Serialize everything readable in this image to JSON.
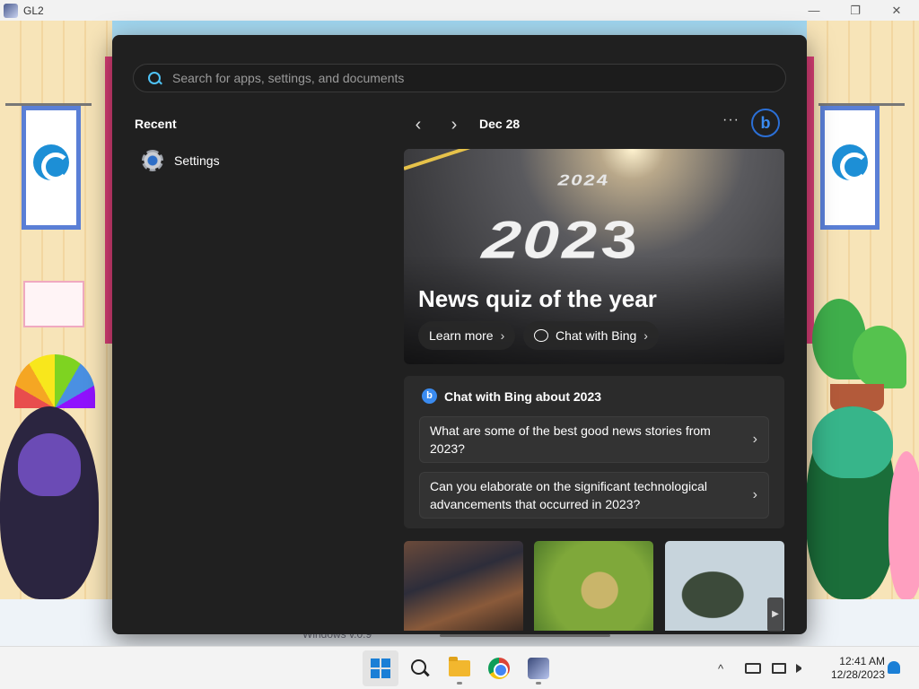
{
  "window": {
    "title": "GL2",
    "minimize": "—",
    "maximize": "❐",
    "close": "✕"
  },
  "game": {
    "footer_text": "Windows v.0.9"
  },
  "start_menu": {
    "search": {
      "placeholder": "Search for apps, settings, and documents",
      "value": ""
    },
    "recent": {
      "title": "Recent",
      "items": [
        {
          "label": "Settings",
          "icon": "settings-gear-icon"
        }
      ]
    },
    "widgets": {
      "prev": "‹",
      "next": "›",
      "date": "Dec 28",
      "more": "···",
      "bing_letter": "b",
      "hero": {
        "small_year": "2024",
        "big_year": "2023",
        "headline": "News quiz of the year",
        "learn_more": "Learn more",
        "chat_with_bing": "Chat with Bing",
        "chevron": "›"
      },
      "chat_card": {
        "title": "Chat with Bing about 2023",
        "icon_letter": "b",
        "questions": [
          "What are some of the best good news stories from 2023?",
          "Can you elaborate on the significant technological advancements that occurred in 2023?"
        ],
        "chevron": "›"
      },
      "thumb_next": "▶"
    }
  },
  "taskbar": {
    "tray_chevron": "^",
    "time": "12:41 AM",
    "date": "12/28/2023"
  },
  "colors": {
    "start_bg": "#202020",
    "accent": "#4fc3f7",
    "bing_blue": "#3a8bf0",
    "taskbar_bg": "#f3f3f3"
  }
}
